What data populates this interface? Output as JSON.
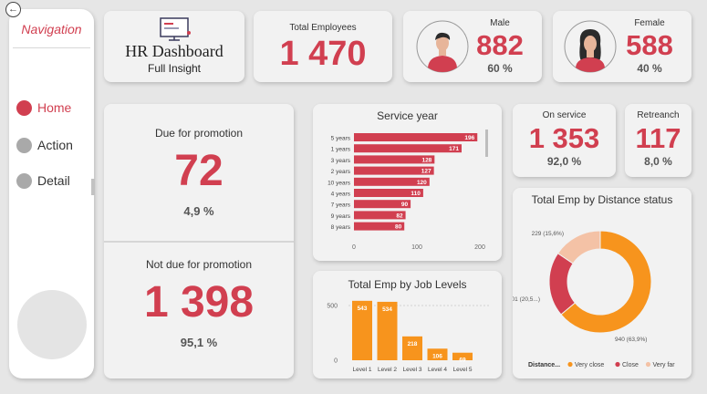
{
  "nav": {
    "title": "Navigation",
    "items": [
      {
        "label": "Home",
        "active": true
      },
      {
        "label": "Action",
        "active": false
      },
      {
        "label": "Detail",
        "active": false
      }
    ]
  },
  "header": {
    "title": "HR Dashboard",
    "subtitle": "Full Insight"
  },
  "kpi": {
    "total_employees": {
      "label": "Total Employees",
      "value": "1 470"
    },
    "male": {
      "label": "Male",
      "value": "882",
      "pct": "60 %"
    },
    "female": {
      "label": "Female",
      "value": "588",
      "pct": "40 %"
    },
    "due_promotion": {
      "label": "Due for promotion",
      "value": "72",
      "pct": "4,9 %"
    },
    "not_due_promotion": {
      "label": "Not due for promotion",
      "value": "1 398",
      "pct": "95,1 %"
    },
    "on_service": {
      "label": "On service",
      "value": "1 353",
      "pct": "92,0 %"
    },
    "retreanch": {
      "label": "Retreanch",
      "value": "117",
      "pct": "8,0 %"
    }
  },
  "colors": {
    "accent": "#d13f50",
    "orange": "#f7941d",
    "peach": "#f4c2a6"
  },
  "chart_data": [
    {
      "type": "bar",
      "orientation": "horizontal",
      "title": "Service year",
      "categories": [
        "5 years",
        "1 years",
        "3 years",
        "2 years",
        "10 years",
        "4 years",
        "7 years",
        "9 years",
        "8 years"
      ],
      "values": [
        196,
        171,
        128,
        127,
        120,
        110,
        90,
        82,
        80
      ],
      "xticks": [
        "0",
        "100",
        "200"
      ],
      "xlim": [
        0,
        200
      ],
      "color": "#d13f50"
    },
    {
      "type": "bar",
      "title": "Total Emp by Job Levels",
      "categories": [
        "Level 1",
        "Level 2",
        "Level 3",
        "Level 4",
        "Level 5"
      ],
      "values": [
        543,
        534,
        218,
        106,
        69
      ],
      "yticks": [
        "500",
        "0"
      ],
      "ylim": [
        0,
        600
      ],
      "color": "#f7941d"
    },
    {
      "type": "pie",
      "donut": true,
      "title": "Total Emp by Distance status",
      "legend_title": "Distance...",
      "legend_position": "bottom",
      "slices": [
        {
          "name": "Very close",
          "value": 940,
          "label": "940 (63,9%)",
          "color": "#f7941d"
        },
        {
          "name": "Close",
          "value": 301,
          "label": "301 (20,5...)",
          "color": "#d13f50"
        },
        {
          "name": "Very far",
          "value": 229,
          "label": "229 (15,6%)",
          "color": "#f4c2a6"
        }
      ]
    }
  ]
}
